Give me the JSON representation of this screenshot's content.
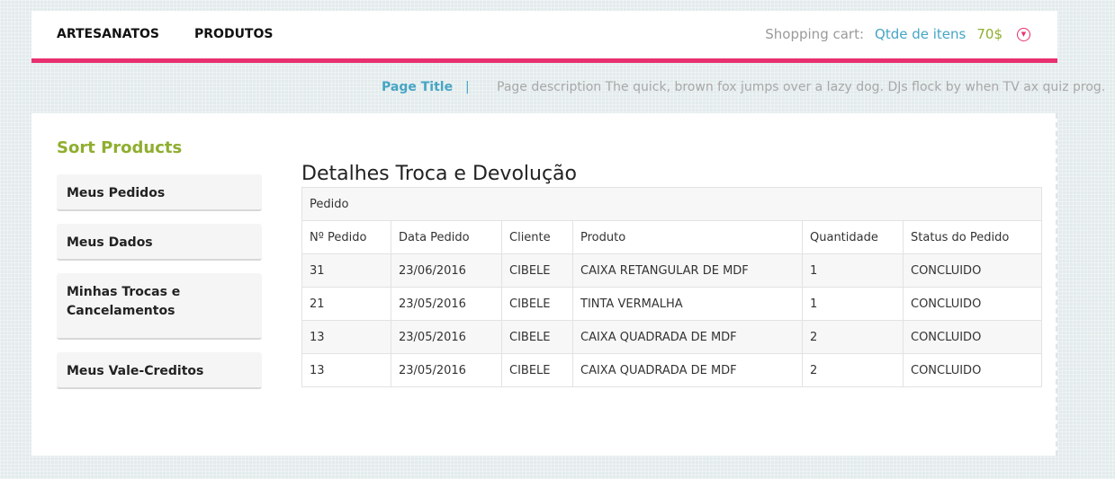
{
  "header": {
    "nav": [
      "ARTESANATOS",
      "PRODUTOS"
    ],
    "cart_label": "Shopping cart:",
    "cart_items": "Qtde de itens",
    "cart_price": "70$",
    "cart_toggle_icon": "chevron-down-icon"
  },
  "title_bar": {
    "page_title": "Page Title",
    "separator": "|",
    "description": "Page description The quick, brown fox jumps over a lazy dog. DJs flock by when TV ax quiz prog."
  },
  "sidebar": {
    "title": "Sort Products",
    "items": [
      "Meus Pedidos",
      "Meus Dados",
      "Minhas Trocas e Cancelamentos",
      "Meus Vale-Creditos"
    ]
  },
  "main": {
    "title": "Detalhes Troca e Devolução",
    "table": {
      "caption": "Pedido",
      "columns": [
        "Nº Pedido",
        "Data Pedido",
        "Cliente",
        "Produto",
        "Quantidade",
        "Status do Pedido"
      ],
      "rows": [
        [
          "31",
          "23/06/2016",
          "CIBELE",
          "CAIXA RETANGULAR DE MDF",
          "1",
          "CONCLUIDO"
        ],
        [
          "21",
          "23/05/2016",
          "CIBELE",
          "TINTA VERMALHA",
          "1",
          "CONCLUIDO"
        ],
        [
          "13",
          "23/05/2016",
          "CIBELE",
          "CAIXA QUADRADA DE MDF",
          "2",
          "CONCLUIDO"
        ],
        [
          "13",
          "23/05/2016",
          "CIBELE",
          "CAIXA QUADRADA DE MDF",
          "2",
          "CONCLUIDO"
        ]
      ]
    }
  },
  "colors": {
    "accent_pink": "#e8306f",
    "accent_blue": "#46a5c4",
    "accent_green": "#8fae2f"
  }
}
